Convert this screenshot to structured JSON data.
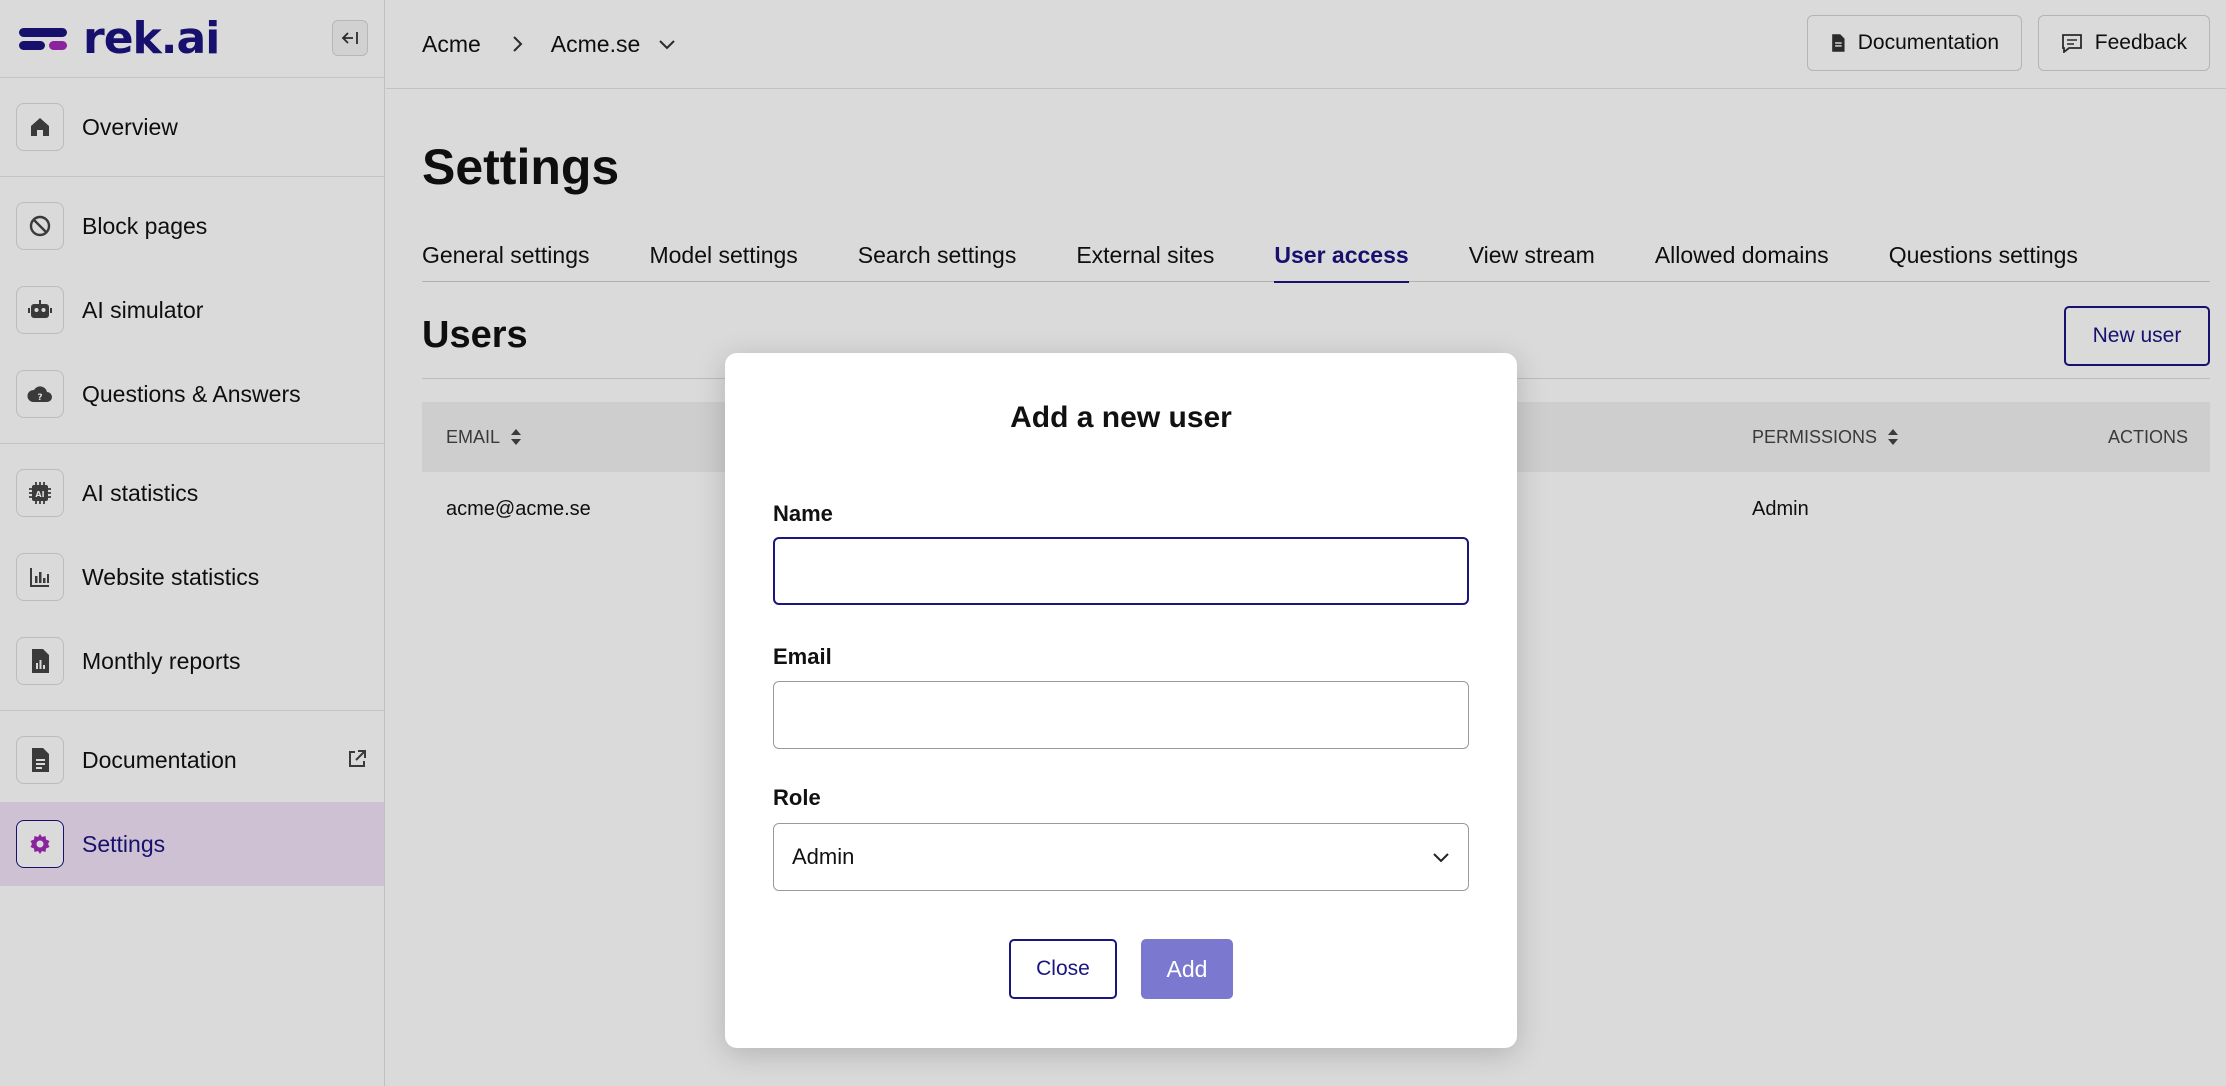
{
  "app": {
    "logo_text": "rek.ai"
  },
  "sidebar": {
    "items": [
      {
        "label": "Overview",
        "icon": "home-icon"
      },
      {
        "label": "Block pages",
        "icon": "block-icon"
      },
      {
        "label": "AI simulator",
        "icon": "robot-icon"
      },
      {
        "label": "Questions & Answers",
        "icon": "cloud-icon"
      },
      {
        "label": "AI statistics",
        "icon": "ai-chip-icon"
      },
      {
        "label": "Website statistics",
        "icon": "bar-chart-icon"
      },
      {
        "label": "Monthly reports",
        "icon": "report-icon"
      },
      {
        "label": "Documentation",
        "icon": "document-icon"
      },
      {
        "label": "Settings",
        "icon": "gear-icon",
        "active": true
      }
    ]
  },
  "breadcrumb": {
    "org": "Acme",
    "site": "Acme.se"
  },
  "topbar": {
    "documentation_label": "Documentation",
    "feedback_label": "Feedback"
  },
  "page": {
    "title": "Settings",
    "tabs": [
      "General settings",
      "Model settings",
      "Search settings",
      "External sites",
      "User access",
      "View stream",
      "Allowed domains",
      "Questions settings"
    ],
    "active_tab": "User access"
  },
  "users": {
    "title": "Users",
    "new_user_label": "New user",
    "columns": {
      "email": "EMAIL",
      "permissions": "PERMISSIONS",
      "actions": "ACTIONS"
    },
    "rows": [
      {
        "email": "acme@acme.se",
        "permissions": "Admin"
      }
    ]
  },
  "modal": {
    "title": "Add a new user",
    "name_label": "Name",
    "name_value": "",
    "email_label": "Email",
    "email_value": "",
    "role_label": "Role",
    "role_value": "Admin",
    "close_label": "Close",
    "add_label": "Add"
  },
  "colors": {
    "brand": "#1b1580",
    "brand_accent": "#a22ab8",
    "active_nav_bg": "#f1e2f7",
    "add_button": "#7b79cf"
  }
}
